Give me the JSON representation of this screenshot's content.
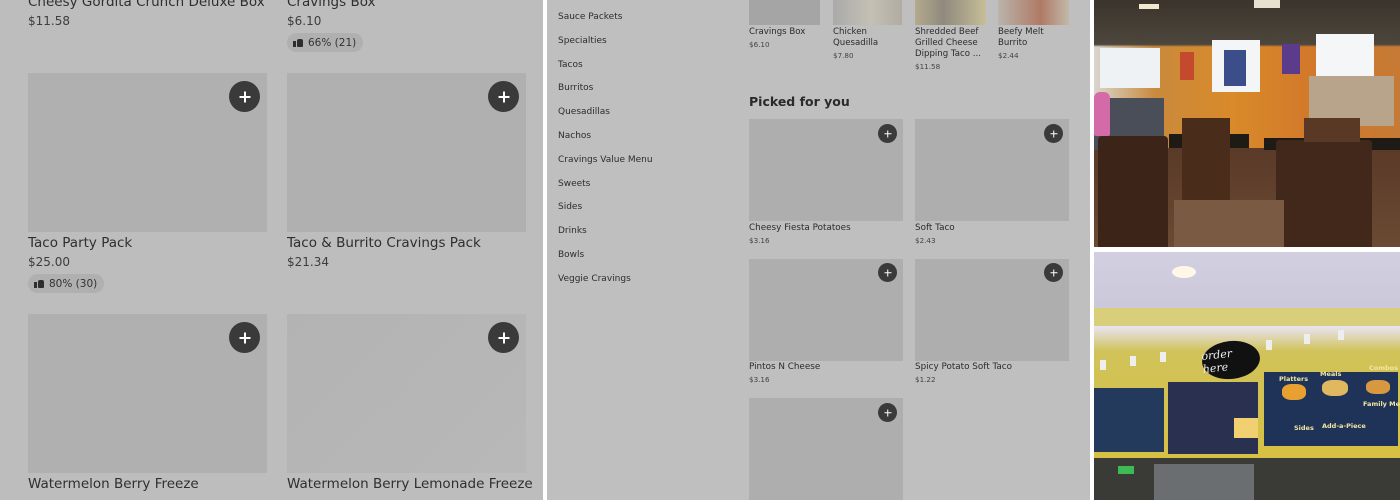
{
  "colors": {
    "overlay": "#bdbdbd",
    "placeholder": "#b0b0b0",
    "add_button": "#3a3a3a",
    "text": "#2f2f2f"
  },
  "left_panel": {
    "items": [
      {
        "name": "Cheesy Gordita Crunch Deluxe Box",
        "price": "$11.58",
        "rating": ""
      },
      {
        "name": "Cravings Box",
        "price": "$6.10",
        "rating": "66% (21)"
      },
      {
        "name": "Taco Party Pack",
        "price": "$25.00",
        "rating": "80% (30)"
      },
      {
        "name": "Taco & Burrito Cravings Pack",
        "price": "$21.34",
        "rating": ""
      },
      {
        "name": "Watermelon Berry Freeze",
        "price": "",
        "rating": ""
      },
      {
        "name": "Watermelon Berry Lemonade Freeze",
        "price": "",
        "rating": ""
      }
    ],
    "add_icon": "plus-icon",
    "rating_icon": "thumbs-up-icon"
  },
  "middle_panel": {
    "categories": [
      "Sauce Packets",
      "Specialties",
      "Tacos",
      "Burritos",
      "Quesadillas",
      "Nachos",
      "Cravings Value Menu",
      "Sweets",
      "Sides",
      "Drinks",
      "Bowls",
      "Veggie Cravings"
    ],
    "top_items": [
      {
        "name": "Cravings Box",
        "price": "$6.10"
      },
      {
        "name": "Chicken Quesadilla",
        "price": "$7.80"
      },
      {
        "name": "Shredded Beef Grilled Cheese Dipping Taco ...",
        "price": "$11.58"
      },
      {
        "name": "Beefy Melt Burrito",
        "price": "$2.44"
      }
    ],
    "picked_title": "Picked for you",
    "picked_items": [
      {
        "name": "Cheesy Fiesta Potatoes",
        "price": "$3.16"
      },
      {
        "name": "Soft Taco",
        "price": "$2.43"
      },
      {
        "name": "Pintos N Cheese",
        "price": "$3.16"
      },
      {
        "name": "Spicy Potato Soft Taco",
        "price": "$1.22"
      }
    ]
  },
  "photos": {
    "dining_room": {
      "icon": "restaurant-interior-photo"
    },
    "order_counter": {
      "sign_text": "order here",
      "menu_labels": [
        "Platters",
        "Meals",
        "Combos",
        "Family Meal",
        "Sides",
        "Add-a-Piece"
      ]
    }
  }
}
